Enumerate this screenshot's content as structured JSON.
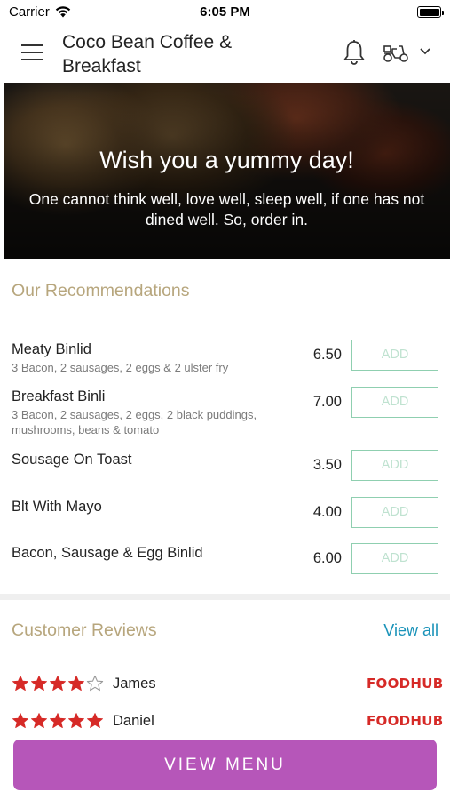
{
  "status_bar": {
    "carrier": "Carrier",
    "time": "6:05 PM"
  },
  "header": {
    "title": "Coco Bean Coffee & Breakfast"
  },
  "hero": {
    "title": "Wish you a yummy day!",
    "subtitle": "One cannot think well, love well, sleep well, if one has not dined well. So, order in."
  },
  "recommendations": {
    "title": "Our Recommendations",
    "add_label": "ADD",
    "items": [
      {
        "name": "Meaty Binlid",
        "description": "3 Bacon, 2 sausages, 2 eggs & 2 ulster fry",
        "price": "6.50"
      },
      {
        "name": "Breakfast Binli",
        "description": "3 Bacon, 2 sausages, 2 eggs, 2 black puddings, mushrooms, beans & tomato",
        "price": "7.00"
      },
      {
        "name": "Sousage On Toast",
        "description": "",
        "price": "3.50"
      },
      {
        "name": "Blt With Mayo",
        "description": "",
        "price": "4.00"
      },
      {
        "name": "Bacon, Sausage & Egg Binlid",
        "description": "",
        "price": "6.00"
      }
    ]
  },
  "reviews": {
    "title": "Customer Reviews",
    "view_all": "View all",
    "items": [
      {
        "name": "James",
        "stars": 4,
        "source": "FOODHUB"
      },
      {
        "name": "Daniel",
        "stars": 5,
        "source": "FOODHUB"
      }
    ]
  },
  "footer": {
    "view_menu_label": "VIEW MENU"
  },
  "colors": {
    "section_title": "#b7a67d",
    "link": "#1a93b9",
    "add_border": "#8fcfb0",
    "star": "#d62a27",
    "brand_logo": "#d62a27",
    "view_menu_bg": "#b656b9"
  },
  "icons": [
    "wifi-icon",
    "battery-icon",
    "menu-icon",
    "bell-icon",
    "scooter-icon",
    "chevron-down-icon",
    "star-icon"
  ]
}
